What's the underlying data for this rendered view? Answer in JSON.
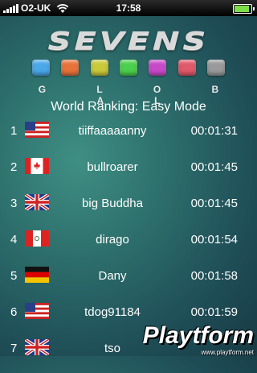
{
  "statusbar": {
    "carrier": "O2-UK",
    "time": "17:58"
  },
  "app": {
    "logo": "SEVENS",
    "subtitle": "G L O B A L",
    "title": "World Ranking: Easy Mode"
  },
  "tiles": [
    "#4aa8e8",
    "#e8733a",
    "#c9c93a",
    "#4cd04c",
    "#c84ac8",
    "#e05a6a",
    "#9a9a9a"
  ],
  "rankings": [
    {
      "rank": "1",
      "flag": "us-flag-icon",
      "name": "tiiffaaaaanny",
      "time": "00:01:31"
    },
    {
      "rank": "2",
      "flag": "ca-flag-icon",
      "name": "bullroarer",
      "time": "00:01:45"
    },
    {
      "rank": "3",
      "flag": "gb-flag-icon",
      "name": "big Buddha",
      "time": "00:01:45"
    },
    {
      "rank": "4",
      "flag": "pe-flag-icon",
      "name": "dirago",
      "time": "00:01:54"
    },
    {
      "rank": "5",
      "flag": "de-flag-icon",
      "name": "Dany",
      "time": "00:01:58"
    },
    {
      "rank": "6",
      "flag": "us-flag-icon",
      "name": "tdog91184",
      "time": "00:01:59"
    },
    {
      "rank": "7",
      "flag": "gb-flag-icon",
      "name": "tso",
      "time": ""
    }
  ],
  "watermark": {
    "text": "Playtform",
    "url": "www.playtform.net"
  }
}
